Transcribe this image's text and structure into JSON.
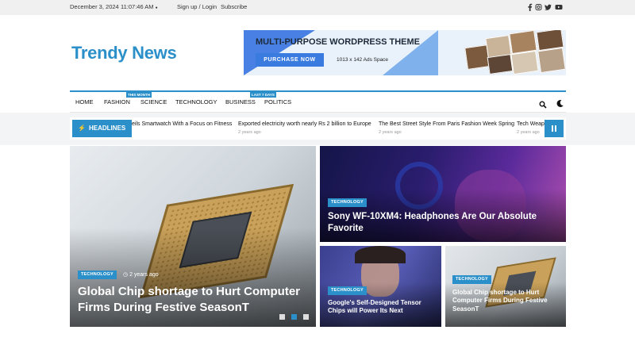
{
  "topbar": {
    "date": "December 3, 2024",
    "time": "11:07:46 AM",
    "sign_in": "Sign up / Login",
    "subscribe": "Subscribe",
    "social_icons": [
      "facebook-icon",
      "instagram-icon",
      "twitter-icon",
      "youtube-icon"
    ]
  },
  "header": {
    "logo": "Trendy News",
    "ad": {
      "title": "MULTI-PURPOSE WORDPRESS THEME",
      "button": "PURCHASE NOW",
      "size": "1013 x 142 Ads Space"
    }
  },
  "nav": {
    "items": [
      "HOME",
      "FASHION",
      "SCIENCE",
      "TECHNOLOGY",
      "BUSINESS",
      "POLITICS"
    ],
    "badges": {
      "fashion": "THIS MONTH",
      "business": "LAST 7 DAYS"
    }
  },
  "ticker": {
    "label": "HEADLINES",
    "items": [
      {
        "title": "eils Smartwatch With a Focus on Fitness",
        "meta": ""
      },
      {
        "title": "Exported electricity worth nearly Rs 2 billion to Europe",
        "meta": "2 years ago"
      },
      {
        "title": "The Best Street Style From Paris Fashion Week Spring",
        "meta": "2 years ago"
      },
      {
        "title": "Tech Weapo",
        "meta": "2 years ago"
      }
    ]
  },
  "posts": {
    "hero": {
      "tag": "TECHNOLOGY",
      "date": "2 years ago",
      "title": "Global Chip shortage to Hurt Computer Firms During Festive SeasonT"
    },
    "sony": {
      "tag": "TECHNOLOGY",
      "title": "Sony WF-10XM4: Headphones Are Our Absolute Favorite"
    },
    "google": {
      "tag": "TECHNOLOGY",
      "title": "Google's Self-Designed Tensor Chips will Power Its Next"
    },
    "chip": {
      "tag": "TECHNOLOGY",
      "title": "Global Chip shortage to Hurt Computer Firms During Festive SeasonT"
    }
  },
  "colors": {
    "accent": "#2b8fc9"
  }
}
